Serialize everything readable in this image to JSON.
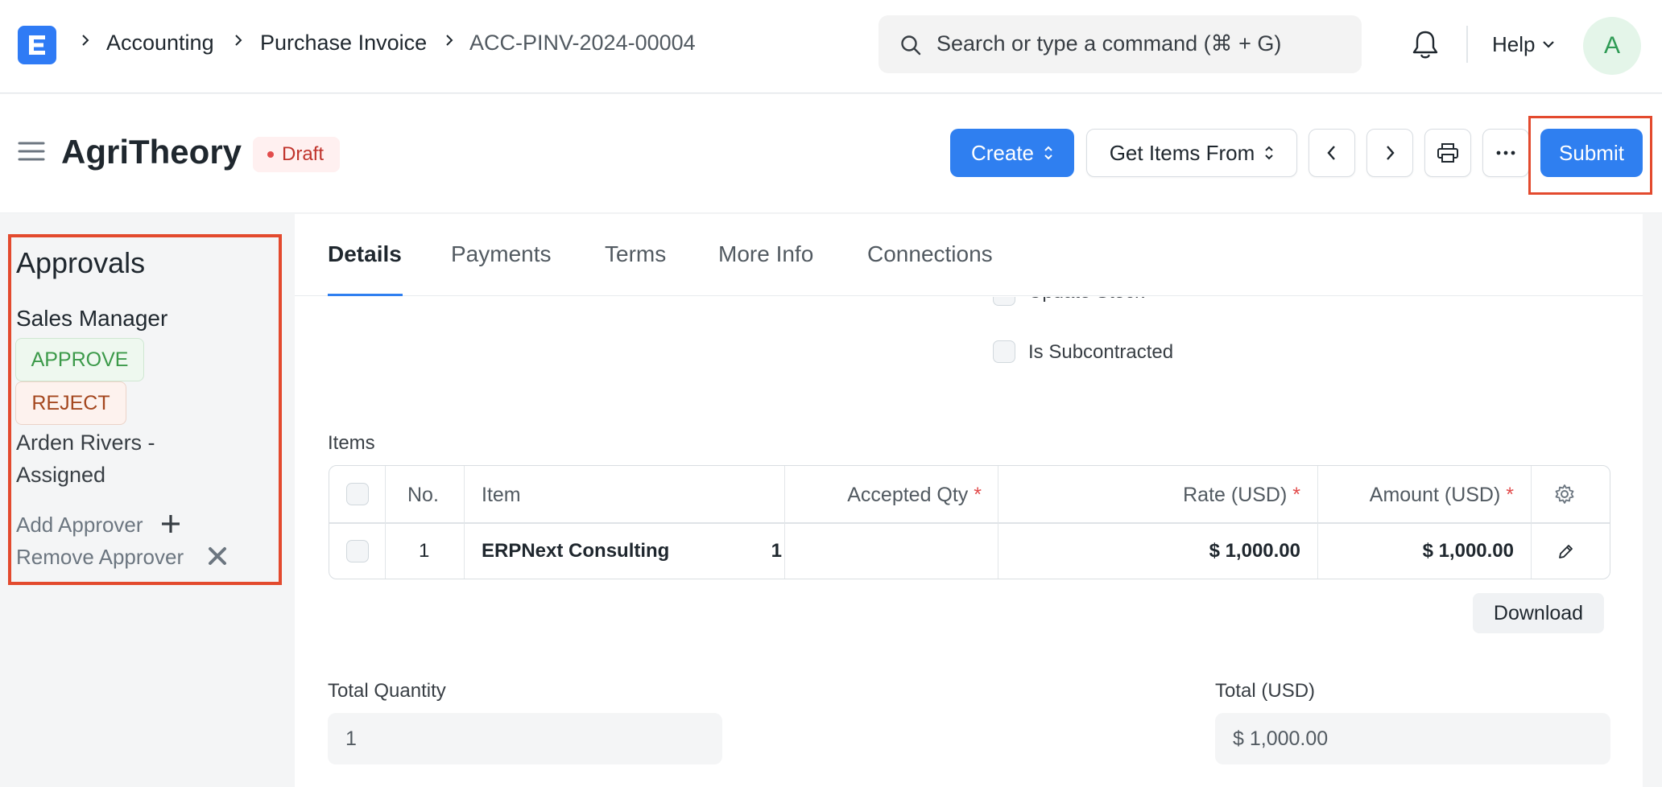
{
  "navbar": {
    "logo_letter": "E",
    "breadcrumbs": [
      "Accounting",
      "Purchase Invoice",
      "ACC-PINV-2024-00004"
    ],
    "search_placeholder": "Search or type a command (⌘ + G)",
    "help_label": "Help",
    "avatar_initial": "A"
  },
  "header": {
    "title": "AgriTheory",
    "status": "Draft",
    "create_label": "Create",
    "get_items_label": "Get Items From",
    "submit_label": "Submit"
  },
  "sidebar": {
    "title": "Approvals",
    "role": "Sales Manager",
    "approve_label": "APPROVE",
    "reject_label": "REJECT",
    "assignee": "Arden Rivers - Assigned",
    "add_approver": "Add Approver",
    "remove_approver": "Remove Approver"
  },
  "tabs": [
    "Details",
    "Payments",
    "Terms",
    "More Info",
    "Connections"
  ],
  "form": {
    "partial_checkbox_label": "Update Stock",
    "subcontracted_label": "Is Subcontracted",
    "items_label": "Items",
    "columns": {
      "no": "No.",
      "item": "Item",
      "accepted_qty": "Accepted Qty",
      "rate": "Rate (USD)",
      "amount": "Amount (USD)",
      "required_mark": "*"
    },
    "rows": [
      {
        "no": "1",
        "item": "ERPNext Consulting",
        "qty": "1",
        "rate": "$ 1,000.00",
        "amount": "$ 1,000.00"
      }
    ],
    "download_label": "Download",
    "total_quantity_label": "Total Quantity",
    "total_quantity_value": "1",
    "total_label": "Total (USD)",
    "total_value": "$ 1,000.00"
  },
  "colors": {
    "primary": "#2f7ff0",
    "highlight": "#e34a2e",
    "draft": "#c0342c",
    "approve": "#3c9a4a",
    "reject": "#a4471f"
  }
}
